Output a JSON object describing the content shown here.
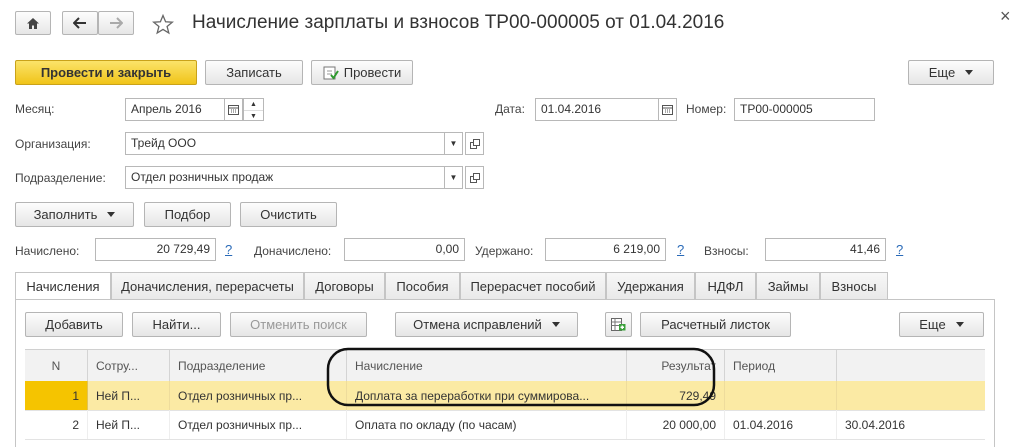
{
  "window": {
    "title": "Начисление зарплаты и взносов ТР00-000005 от 01.04.2016",
    "close_glyph": "×"
  },
  "toolbar": {
    "post_close": "Провести и закрыть",
    "save": "Записать",
    "post": "Провести",
    "more": "Еще"
  },
  "form": {
    "month_label": "Месяц:",
    "month_value": "Апрель 2016",
    "date_label": "Дата:",
    "date_value": "01.04.2016",
    "number_label": "Номер:",
    "number_value": "ТР00-000005",
    "org_label": "Организация:",
    "org_value": "Трейд ООО",
    "dept_label": "Подразделение:",
    "dept_value": "Отдел розничных продаж"
  },
  "actions": {
    "fill": "Заполнить",
    "pick": "Подбор",
    "clear": "Очистить"
  },
  "totals": {
    "accrued_label": "Начислено:",
    "accrued_value": "20 729,49",
    "extra_label": "Доначислено:",
    "extra_value": "0,00",
    "withheld_label": "Удержано:",
    "withheld_value": "6 219,00",
    "contrib_label": "Взносы:",
    "contrib_value": "41,46",
    "help": "?"
  },
  "tabs": [
    "Начисления",
    "Доначисления, перерасчеты",
    "Договоры",
    "Пособия",
    "Перерасчет пособий",
    "Удержания",
    "НДФЛ",
    "Займы",
    "Взносы"
  ],
  "tab_toolbar": {
    "add": "Добавить",
    "find": "Найти...",
    "cancel_search": "Отменить поиск",
    "cancel_fixes": "Отмена исправлений",
    "payslip": "Расчетный листок",
    "more": "Еще"
  },
  "table": {
    "headers": [
      "N",
      "Сотру...",
      "Подразделение",
      "Начисление",
      "Результат",
      "Период",
      ""
    ],
    "rows": [
      [
        "1",
        "Ней П...",
        "Отдел розничных пр...",
        "Доплата за переработки при суммирова...",
        "729,49",
        "",
        ""
      ],
      [
        "2",
        "Ней П...",
        "Отдел розничных пр...",
        "Оплата по окладу (по часам)",
        "20 000,00",
        "01.04.2016",
        "30.04.2016"
      ]
    ]
  },
  "icons": {
    "home": "home-icon",
    "back": "arrow-left-icon",
    "forward": "arrow-right-icon",
    "favorite": "star-icon",
    "calendar": "calendar-icon",
    "open": "open-form-icon",
    "spreadsheet": "spreadsheet-icon"
  },
  "colors": {
    "primary_button": "#f3cc2d",
    "selected_row": "#fbeaa4",
    "selected_marker": "#f5c400",
    "link": "#2a6ab8"
  }
}
